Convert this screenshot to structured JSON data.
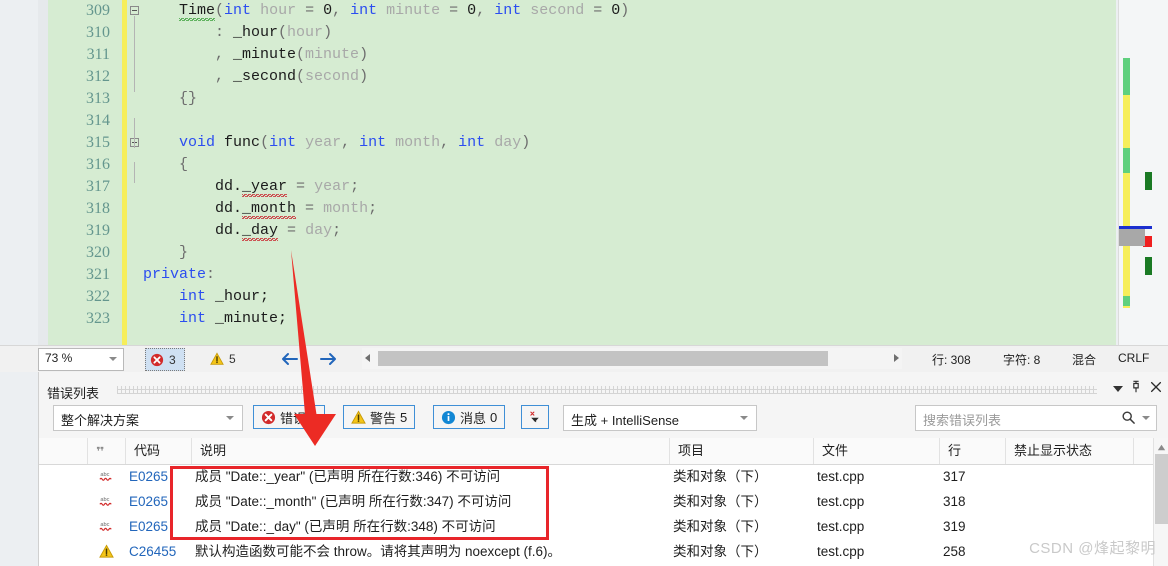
{
  "editor": {
    "lines": [
      {
        "num": 309,
        "fold": true,
        "tokens": [
          {
            "t": "    ",
            "c": "pun"
          },
          {
            "t": "Time",
            "c": "id sq-green"
          },
          {
            "t": "(",
            "c": "pun"
          },
          {
            "t": "int",
            "c": "kw"
          },
          {
            "t": " hour ",
            "c": "dim"
          },
          {
            "t": "= ",
            "c": "pun"
          },
          {
            "t": "0",
            "c": "num"
          },
          {
            "t": ", ",
            "c": "pun"
          },
          {
            "t": "int",
            "c": "kw"
          },
          {
            "t": " minute ",
            "c": "dim"
          },
          {
            "t": "= ",
            "c": "pun"
          },
          {
            "t": "0",
            "c": "num"
          },
          {
            "t": ", ",
            "c": "pun"
          },
          {
            "t": "int",
            "c": "kw"
          },
          {
            "t": " second ",
            "c": "dim"
          },
          {
            "t": "= ",
            "c": "pun"
          },
          {
            "t": "0",
            "c": "num"
          },
          {
            "t": ")",
            "c": "pun"
          }
        ]
      },
      {
        "num": 310,
        "fold": false,
        "tokens": [
          {
            "t": "        : ",
            "c": "pun"
          },
          {
            "t": "_hour",
            "c": "id"
          },
          {
            "t": "(",
            "c": "pun"
          },
          {
            "t": "hour",
            "c": "dim"
          },
          {
            "t": ")",
            "c": "pun"
          }
        ]
      },
      {
        "num": 311,
        "fold": false,
        "tokens": [
          {
            "t": "        , ",
            "c": "pun"
          },
          {
            "t": "_minute",
            "c": "id"
          },
          {
            "t": "(",
            "c": "pun"
          },
          {
            "t": "minute",
            "c": "dim"
          },
          {
            "t": ")",
            "c": "pun"
          }
        ]
      },
      {
        "num": 312,
        "fold": false,
        "tokens": [
          {
            "t": "        , ",
            "c": "pun"
          },
          {
            "t": "_second",
            "c": "id"
          },
          {
            "t": "(",
            "c": "pun"
          },
          {
            "t": "second",
            "c": "dim"
          },
          {
            "t": ")",
            "c": "pun"
          }
        ]
      },
      {
        "num": 313,
        "fold": false,
        "tokens": [
          {
            "t": "    {}",
            "c": "pun"
          }
        ]
      },
      {
        "num": 314,
        "fold": false,
        "tokens": []
      },
      {
        "num": 315,
        "fold": true,
        "tokens": [
          {
            "t": "    ",
            "c": "pun"
          },
          {
            "t": "void",
            "c": "kw"
          },
          {
            "t": " ",
            "c": "pun"
          },
          {
            "t": "func",
            "c": "id"
          },
          {
            "t": "(",
            "c": "pun"
          },
          {
            "t": "int",
            "c": "kw"
          },
          {
            "t": " year",
            "c": "dim"
          },
          {
            "t": ", ",
            "c": "pun"
          },
          {
            "t": "int",
            "c": "kw"
          },
          {
            "t": " month",
            "c": "dim"
          },
          {
            "t": ", ",
            "c": "pun"
          },
          {
            "t": "int",
            "c": "kw"
          },
          {
            "t": " day",
            "c": "dim"
          },
          {
            "t": ")",
            "c": "pun"
          }
        ]
      },
      {
        "num": 316,
        "fold": false,
        "tokens": [
          {
            "t": "    {",
            "c": "pun"
          }
        ]
      },
      {
        "num": 317,
        "fold": false,
        "tokens": [
          {
            "t": "        dd.",
            "c": "id"
          },
          {
            "t": "_year",
            "c": "id sq-red"
          },
          {
            "t": " = ",
            "c": "pun"
          },
          {
            "t": "year",
            "c": "dim"
          },
          {
            "t": ";",
            "c": "pun"
          }
        ]
      },
      {
        "num": 318,
        "fold": false,
        "tokens": [
          {
            "t": "        dd.",
            "c": "id"
          },
          {
            "t": "_month",
            "c": "id sq-red"
          },
          {
            "t": " = ",
            "c": "pun"
          },
          {
            "t": "month",
            "c": "dim"
          },
          {
            "t": ";",
            "c": "pun"
          }
        ]
      },
      {
        "num": 319,
        "fold": false,
        "tokens": [
          {
            "t": "        dd.",
            "c": "id"
          },
          {
            "t": "_day",
            "c": "id sq-red"
          },
          {
            "t": " = ",
            "c": "pun"
          },
          {
            "t": "day",
            "c": "dim"
          },
          {
            "t": ";",
            "c": "pun"
          }
        ]
      },
      {
        "num": 320,
        "fold": false,
        "tokens": [
          {
            "t": "    }",
            "c": "pun"
          }
        ]
      },
      {
        "num": 321,
        "fold": false,
        "tokens": [
          {
            "t": "private",
            "c": "kw"
          },
          {
            "t": ":",
            "c": "pun"
          }
        ]
      },
      {
        "num": 322,
        "fold": false,
        "tokens": [
          {
            "t": "    ",
            "c": "pun"
          },
          {
            "t": "int",
            "c": "kw"
          },
          {
            "t": " _hour;",
            "c": "id"
          }
        ]
      },
      {
        "num": 323,
        "fold": false,
        "tokens": [
          {
            "t": "    ",
            "c": "pun"
          },
          {
            "t": "int",
            "c": "kw"
          },
          {
            "t": " _minute;",
            "c": "id"
          }
        ]
      }
    ],
    "background_color": "#d6ecd2",
    "change_bar_color": "#f6ee5a"
  },
  "statusbar": {
    "zoom": "73 %",
    "error_count": "3",
    "warning_count": "5",
    "nav_back_icon": "arrow-left-icon",
    "nav_forward_icon": "arrow-right-icon",
    "line_label": "行: 308",
    "column_label": "字符: 8",
    "insert_mode": "混合",
    "eol": "CRLF"
  },
  "panel": {
    "title": "错误列表",
    "caret_icon": "chevron-down-icon",
    "pin_icon": "pin-icon",
    "close_icon": "close-icon",
    "toolbar": {
      "scope": "整个解决方案",
      "errors_label": "错误",
      "errors_count": "3",
      "warnings_label": "警告",
      "warnings_count": "5",
      "messages_label": "消息",
      "messages_count": "0",
      "filter_icon": "clear-filter-icon",
      "build_filter": "生成 + IntelliSense",
      "search_placeholder": "搜索错误列表",
      "search_value": ""
    },
    "columns": [
      {
        "key": "sev",
        "label": ""
      },
      {
        "key": "code",
        "label": "代码"
      },
      {
        "key": "desc",
        "label": "说明"
      },
      {
        "key": "project",
        "label": "项目"
      },
      {
        "key": "file",
        "label": "文件"
      },
      {
        "key": "line",
        "label": "行"
      },
      {
        "key": "suppress",
        "label": "禁止显示状态"
      }
    ],
    "rows": [
      {
        "sev": "intellisense-error",
        "code": "E0265",
        "desc": "成员 \"Date::_year\" (已声明 所在行数:346) 不可访问",
        "project": "类和对象（下）",
        "file": "test.cpp",
        "line": "317",
        "suppress": ""
      },
      {
        "sev": "intellisense-error",
        "code": "E0265",
        "desc": "成员 \"Date::_month\" (已声明 所在行数:347) 不可访问",
        "project": "类和对象（下）",
        "file": "test.cpp",
        "line": "318",
        "suppress": ""
      },
      {
        "sev": "intellisense-error",
        "code": "E0265",
        "desc": "成员 \"Date::_day\" (已声明 所在行数:348) 不可访问",
        "project": "类和对象（下）",
        "file": "test.cpp",
        "line": "319",
        "suppress": ""
      },
      {
        "sev": "warning",
        "code": "C26455",
        "desc": "默认构造函数可能不会 throw。请将其声明为 noexcept (f.6)。",
        "project": "类和对象（下）",
        "file": "test.cpp",
        "line": "258",
        "suppress": ""
      }
    ]
  },
  "annotations": {
    "highlight_color": "#e8252a",
    "arrow_color": "#ec2b24"
  },
  "watermark": "CSDN @烽起黎明"
}
